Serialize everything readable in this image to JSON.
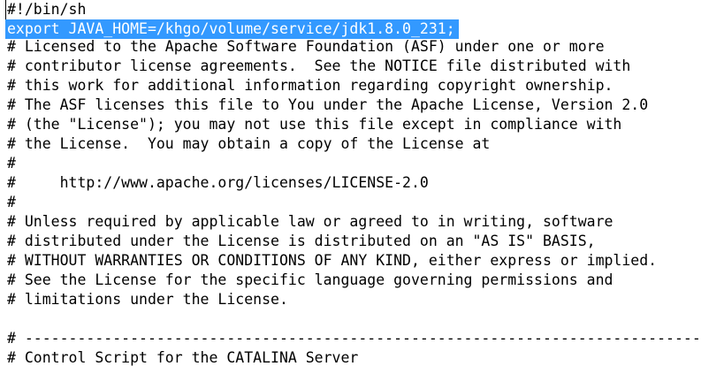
{
  "editor": {
    "lines": [
      "#!/bin/sh",
      "export JAVA_HOME=/khgo/volume/service/jdk1.8.0_231;",
      "# Licensed to the Apache Software Foundation (ASF) under one or more",
      "# contributor license agreements.  See the NOTICE file distributed with",
      "# this work for additional information regarding copyright ownership.",
      "# The ASF licenses this file to You under the Apache License, Version 2.0",
      "# (the \"License\"); you may not use this file except in compliance with",
      "# the License.  You may obtain a copy of the License at",
      "#",
      "#     http://www.apache.org/licenses/LICENSE-2.0",
      "#",
      "# Unless required by applicable law or agreed to in writing, software",
      "# distributed under the License is distributed on an \"AS IS\" BASIS,",
      "# WITHOUT WARRANTIES OR CONDITIONS OF ANY KIND, either express or implied.",
      "# See the License for the specific language governing permissions and",
      "# limitations under the License.",
      "",
      "# -----------------------------------------------------------------------------",
      "# Control Script for the CATALINA Server"
    ],
    "selected_line_index": 1,
    "selection_color": "#3399ff"
  }
}
